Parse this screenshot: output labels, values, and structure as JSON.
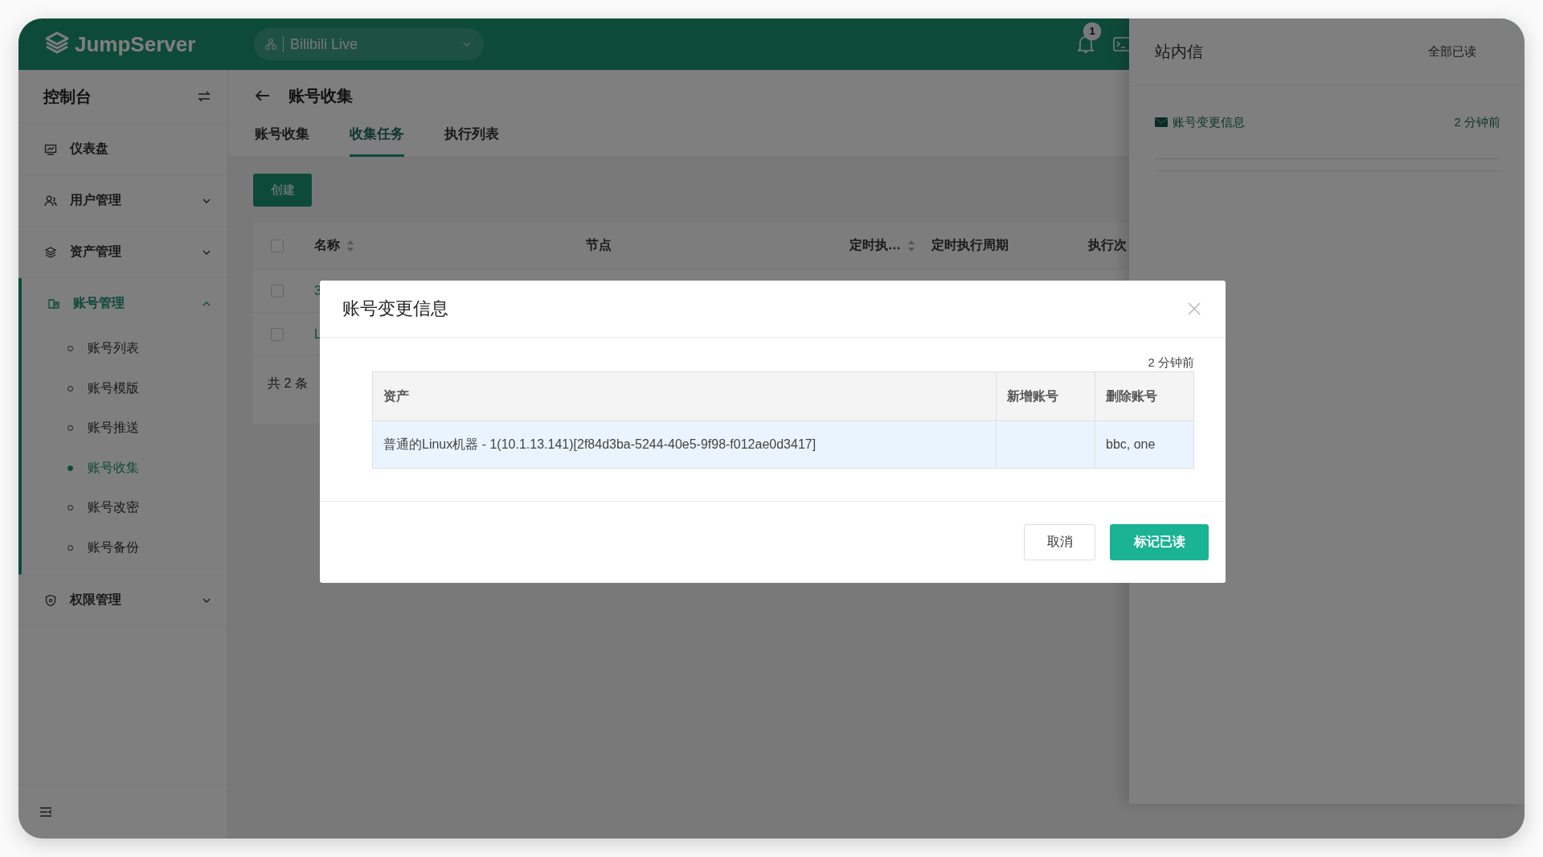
{
  "header": {
    "logo": "JumpServer",
    "workspace": "Bilibili Live",
    "notification_count": "1"
  },
  "sidebar": {
    "title": "控制台",
    "items": [
      {
        "label": "仪表盘"
      },
      {
        "label": "用户管理",
        "expanded": false
      },
      {
        "label": "资产管理",
        "expanded": false
      },
      {
        "label": "账号管理",
        "expanded": true,
        "children": [
          {
            "label": "账号列表",
            "selected": false
          },
          {
            "label": "账号模版",
            "selected": false
          },
          {
            "label": "账号推送",
            "selected": false
          },
          {
            "label": "账号收集",
            "selected": true
          },
          {
            "label": "账号改密",
            "selected": false
          },
          {
            "label": "账号备份",
            "selected": false
          }
        ]
      },
      {
        "label": "权限管理",
        "expanded": false
      }
    ]
  },
  "page": {
    "title": "账号收集",
    "tabs": [
      {
        "label": "账号收集",
        "selected": false
      },
      {
        "label": "收集任务",
        "selected": true
      },
      {
        "label": "执行列表",
        "selected": false
      }
    ],
    "create_button": "创建",
    "table": {
      "select_all_checked": false,
      "columns": [
        {
          "label": "名称",
          "sortable": true
        },
        {
          "label": "节点",
          "sortable": false
        },
        {
          "label": "定时执…",
          "sortable": true
        },
        {
          "label": "定时执行周期",
          "sortable": false
        },
        {
          "label": "执行次"
        }
      ],
      "rows": [
        {
          "name": "3",
          "checked": false
        },
        {
          "name": "L",
          "checked": false
        }
      ]
    },
    "total": "共 2 条"
  },
  "drawer": {
    "title": "站内信",
    "mark_all": "全部已读",
    "messages": [
      {
        "title": "账号变更信息",
        "time": "2 分钟前"
      }
    ]
  },
  "modal": {
    "title": "账号变更信息",
    "time": "2 分钟前",
    "columns": [
      "资产",
      "新增账号",
      "删除账号"
    ],
    "rows": [
      {
        "asset": "普通的Linux机器 - 1(10.1.13.141)[2f84d3ba-5244-40e5-9f98-f012ae0d3417]",
        "deleted": "bbc, one"
      }
    ],
    "buttons": [
      {
        "label": "取消",
        "kind": "default"
      },
      {
        "label": "标记已读",
        "kind": "primary"
      }
    ]
  }
}
